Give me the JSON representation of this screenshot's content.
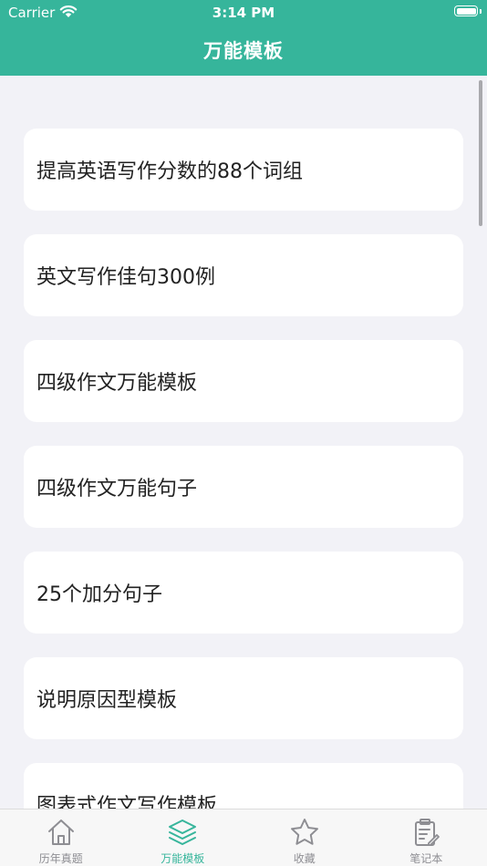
{
  "status_bar": {
    "carrier": "Carrier",
    "time": "3:14 PM"
  },
  "nav": {
    "title": "万能模板"
  },
  "list": {
    "items": [
      {
        "label": "提高英语写作分数的88个词组"
      },
      {
        "label": "英文写作佳句300例"
      },
      {
        "label": "四级作文万能模板"
      },
      {
        "label": "四级作文万能句子"
      },
      {
        "label": "25个加分句子"
      },
      {
        "label": "说明原因型模板"
      },
      {
        "label": "图表式作文写作模板"
      }
    ]
  },
  "tabbar": {
    "active_color": "#36b59b",
    "inactive_color": "#8e8e93",
    "tabs": [
      {
        "label": "历年真题",
        "icon": "home-icon",
        "active": false
      },
      {
        "label": "万能模板",
        "icon": "layers-icon",
        "active": true
      },
      {
        "label": "收藏",
        "icon": "star-icon",
        "active": false
      },
      {
        "label": "笔记本",
        "icon": "clipboard-edit-icon",
        "active": false
      }
    ]
  },
  "colors": {
    "header": "#36b59b",
    "background": "#f2f2f7",
    "card": "#ffffff"
  }
}
